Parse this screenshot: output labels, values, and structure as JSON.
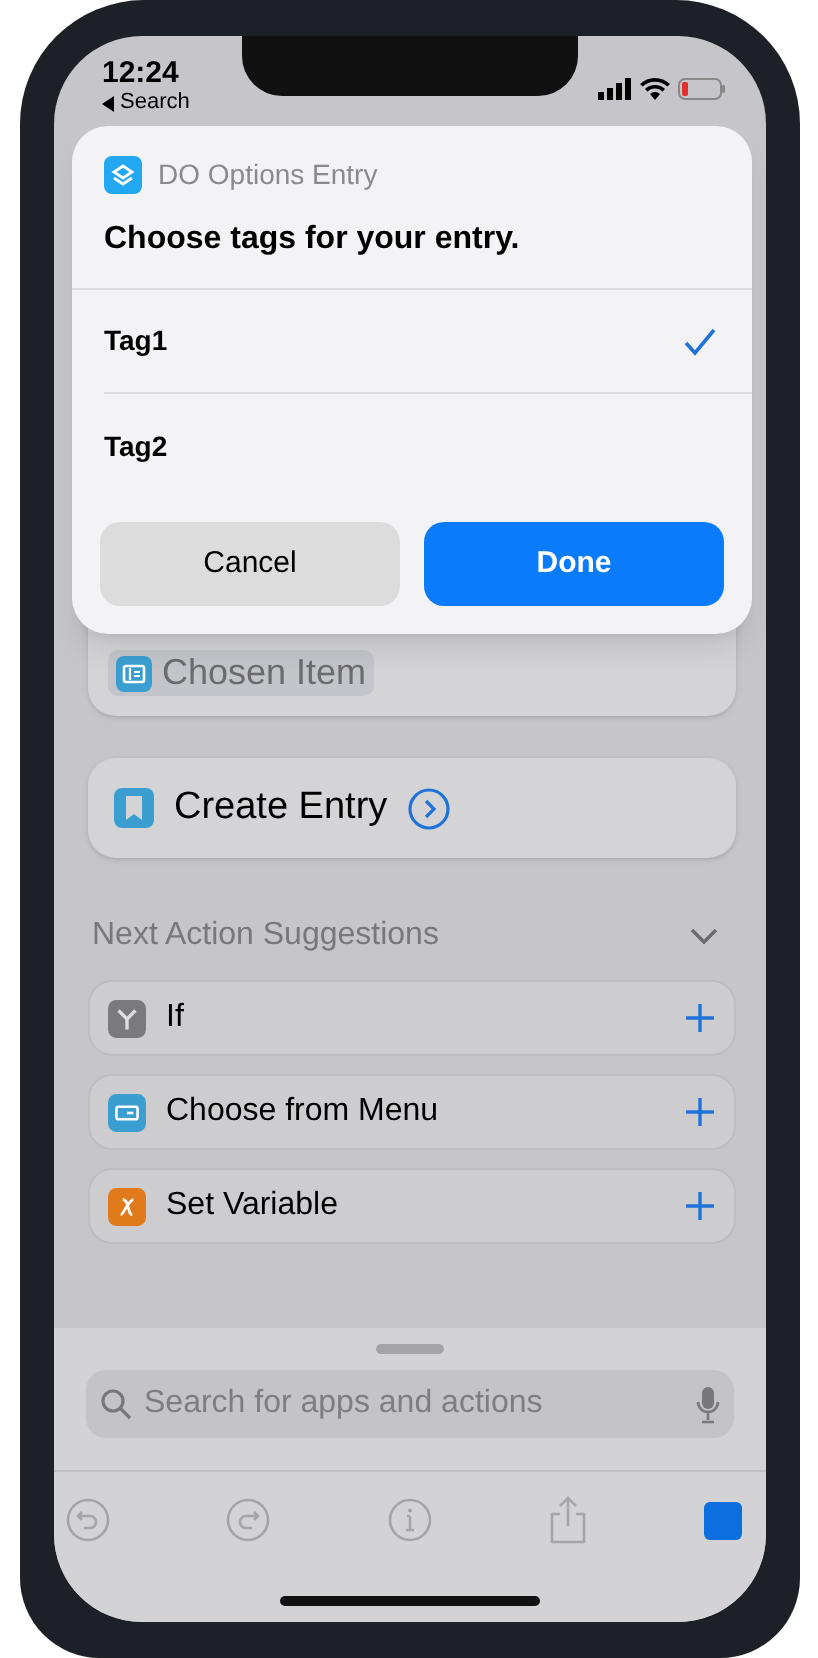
{
  "status_bar": {
    "time": "12:24",
    "back_label": "Search"
  },
  "dialog": {
    "app_name": "DO Options Entry",
    "prompt": "Choose tags for your entry.",
    "options": [
      {
        "label": "Tag1",
        "selected": true
      },
      {
        "label": "Tag2",
        "selected": false
      }
    ],
    "buttons": [
      {
        "label": "Cancel",
        "kind": "secondary"
      },
      {
        "label": "Done",
        "kind": "primary"
      }
    ]
  },
  "workflow": {
    "variable_token": "Chosen Item",
    "action": "Create Entry"
  },
  "suggestions": {
    "title": "Next Action Suggestions",
    "expanded": true,
    "items": [
      {
        "label": "If",
        "kind": "branch",
        "color": "#7a7a7e"
      },
      {
        "label": "Choose from Menu",
        "kind": "menu",
        "color": "#3a9fd0"
      },
      {
        "label": "Set Variable",
        "kind": "variable",
        "color": "#e07a1a"
      }
    ]
  },
  "search": {
    "placeholder": "Search for apps and actions"
  }
}
